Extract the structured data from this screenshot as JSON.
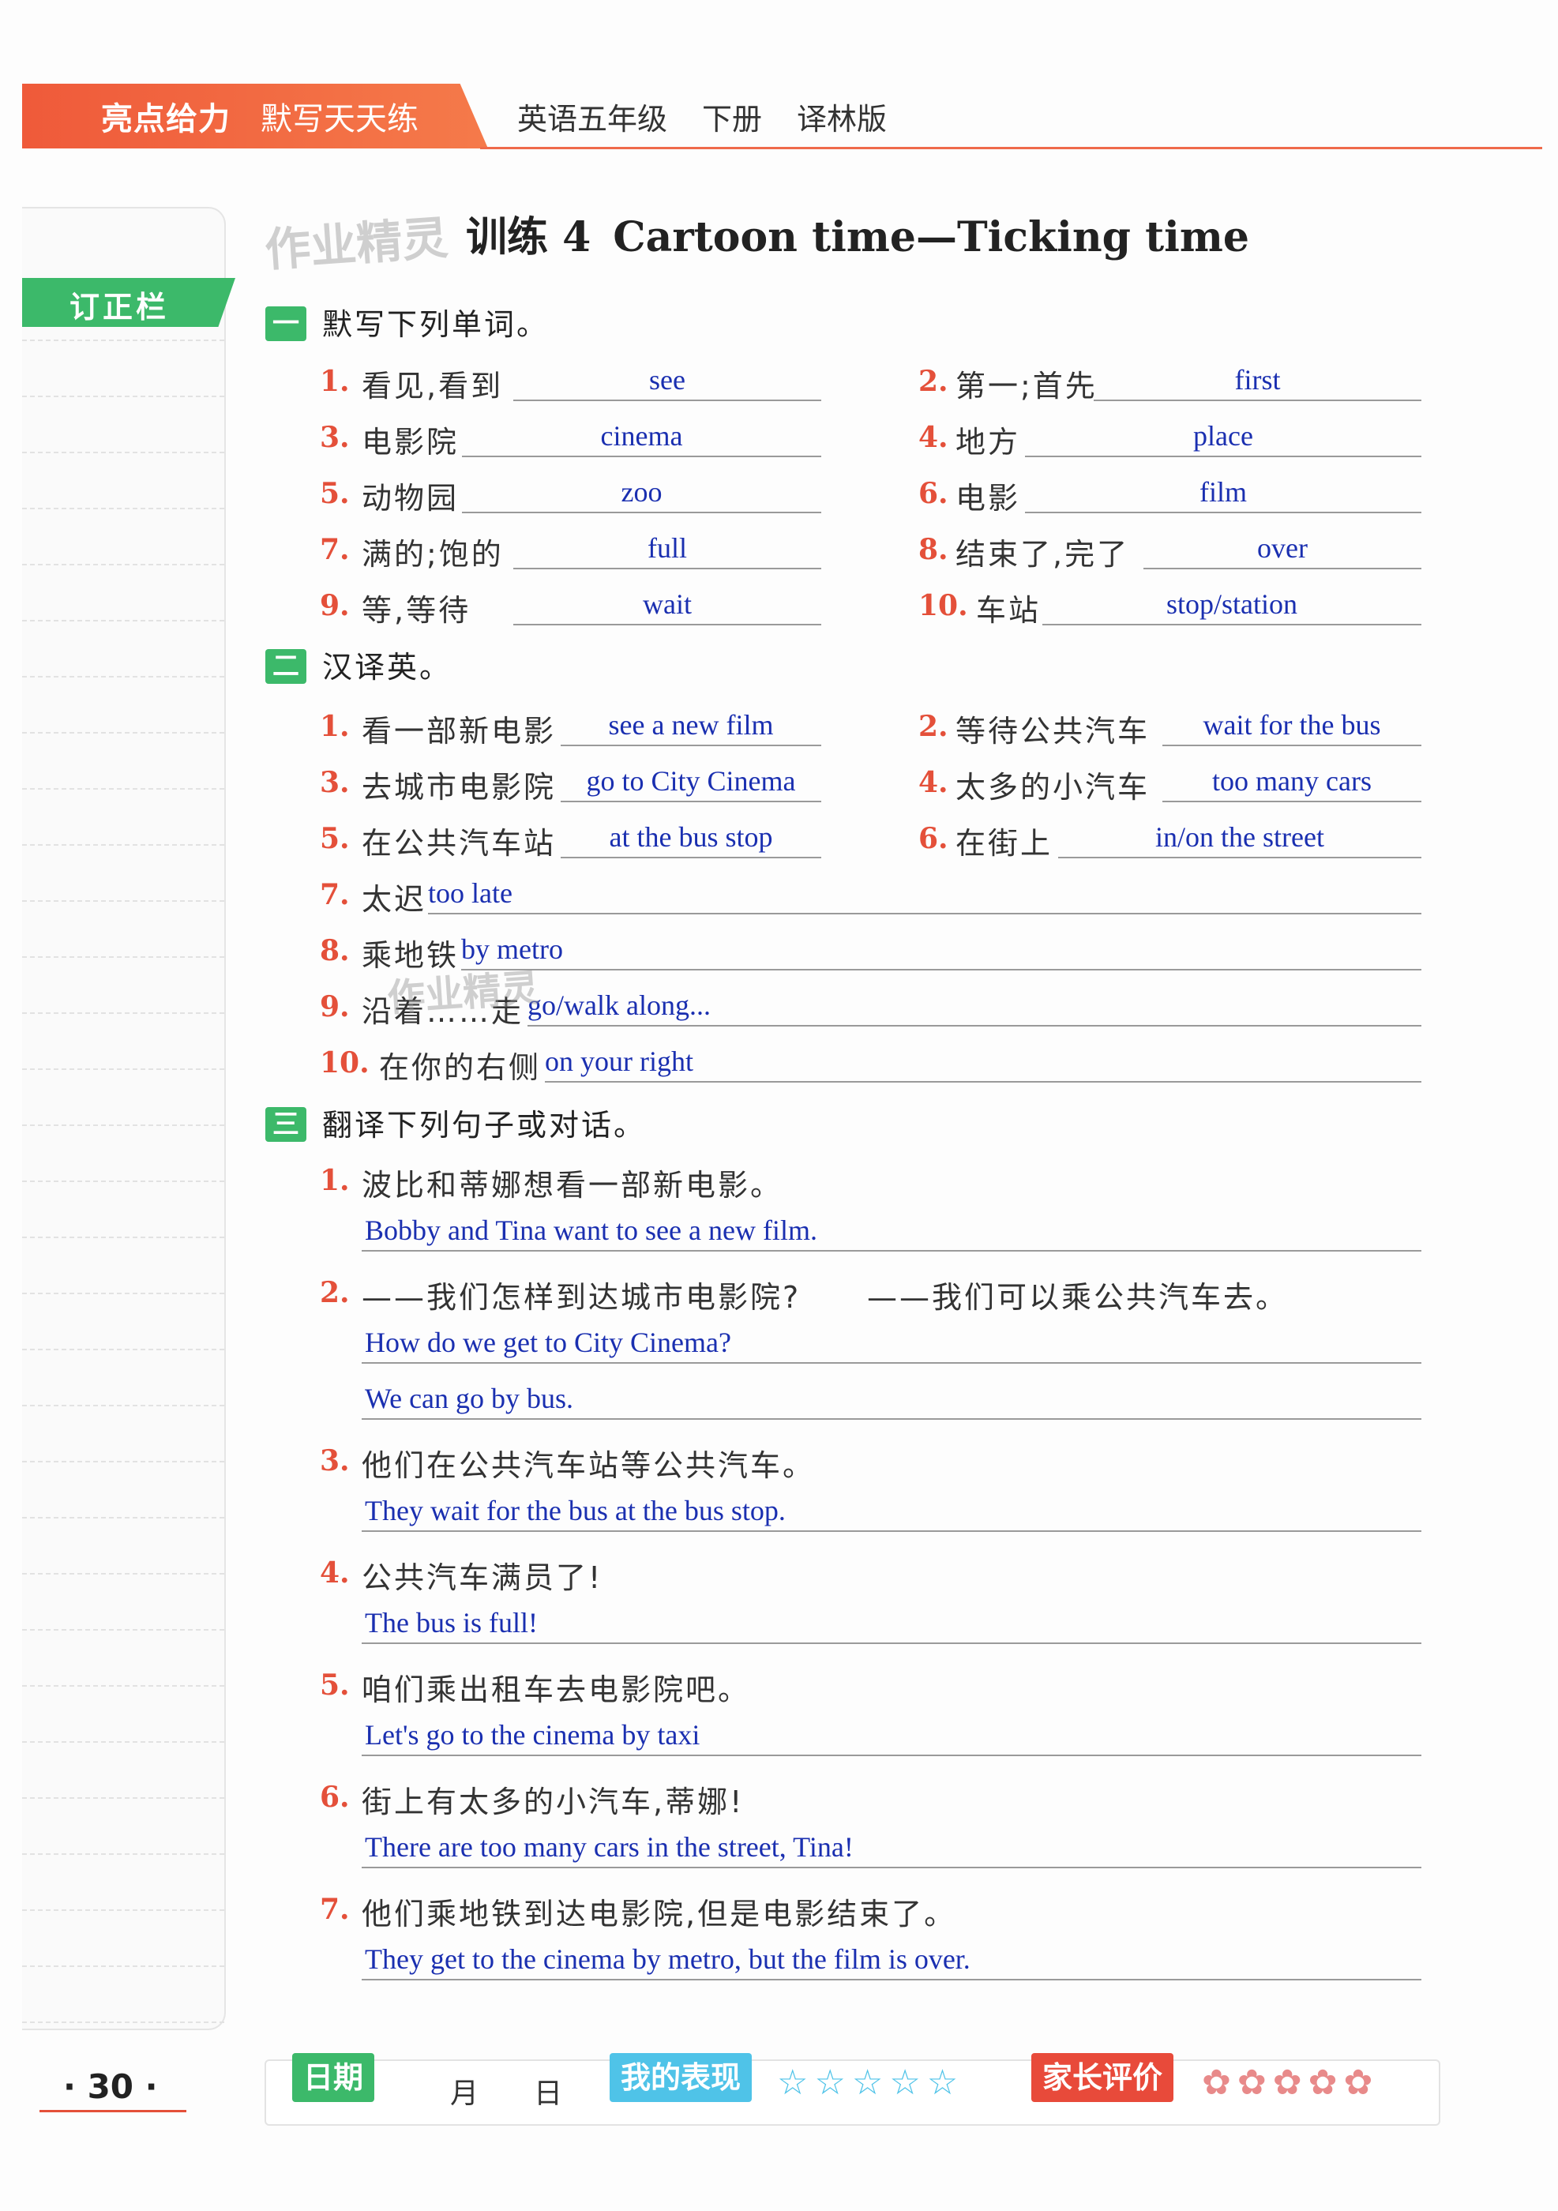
{
  "header": {
    "brand": "亮点给力",
    "series": "默写天天练",
    "subject": "英语五年级",
    "volume": "下册",
    "edition": "译林版"
  },
  "sidebar": {
    "tab_label": "订正栏"
  },
  "watermark": "作业精灵",
  "title": {
    "cn": "训练 4",
    "en": "Cartoon time—Ticking time"
  },
  "section1": {
    "badge": "一",
    "title": "默写下列单词。",
    "items": [
      {
        "num": "1.",
        "cn": "看见,看到",
        "answer": "see"
      },
      {
        "num": "2.",
        "cn": "第一;首先",
        "answer": "first"
      },
      {
        "num": "3.",
        "cn": "电影院",
        "answer": "cinema"
      },
      {
        "num": "4.",
        "cn": "地方",
        "answer": "place"
      },
      {
        "num": "5.",
        "cn": "动物园",
        "answer": "zoo"
      },
      {
        "num": "6.",
        "cn": "电影",
        "answer": "film"
      },
      {
        "num": "7.",
        "cn": "满的;饱的",
        "answer": "full"
      },
      {
        "num": "8.",
        "cn": "结束了,完了",
        "answer": "over"
      },
      {
        "num": "9.",
        "cn": "等,等待",
        "answer": "wait"
      },
      {
        "num": "10.",
        "cn": "车站",
        "answer": "stop/station"
      }
    ]
  },
  "section2": {
    "badge": "二",
    "title": "汉译英。",
    "items": [
      {
        "num": "1.",
        "cn": "看一部新电影",
        "answer": "see a new film"
      },
      {
        "num": "2.",
        "cn": "等待公共汽车",
        "answer": "wait for the bus"
      },
      {
        "num": "3.",
        "cn": "去城市电影院",
        "answer": "go to City Cinema"
      },
      {
        "num": "4.",
        "cn": "太多的小汽车",
        "answer": "too many cars"
      },
      {
        "num": "5.",
        "cn": "在公共汽车站",
        "answer": "at the bus stop"
      },
      {
        "num": "6.",
        "cn": "在街上",
        "answer": "in/on the street"
      },
      {
        "num": "7.",
        "cn": "太迟",
        "answer": "too late"
      },
      {
        "num": "8.",
        "cn": "乘地铁",
        "answer": "by metro"
      },
      {
        "num": "9.",
        "cn": "沿着……走",
        "answer": "go/walk along..."
      },
      {
        "num": "10.",
        "cn": "在你的右侧",
        "answer": "on your right"
      }
    ]
  },
  "section3": {
    "badge": "三",
    "title": "翻译下列句子或对话。",
    "items": [
      {
        "num": "1.",
        "cn": "波比和蒂娜想看一部新电影。",
        "answers": [
          "Bobby and Tina want to see a new film."
        ]
      },
      {
        "num": "2.",
        "cn": "——我们怎样到达城市电影院?",
        "cn2": "——我们可以乘公共汽车去。",
        "answers": [
          "How do we get to City Cinema?",
          "We can go by bus."
        ]
      },
      {
        "num": "3.",
        "cn": "他们在公共汽车站等公共汽车。",
        "answers": [
          "They wait for the bus at the bus stop."
        ]
      },
      {
        "num": "4.",
        "cn": "公共汽车满员了!",
        "answers": [
          "The bus is full!"
        ]
      },
      {
        "num": "5.",
        "cn": "咱们乘出租车去电影院吧。",
        "answers": [
          "Let's go to the cinema by taxi"
        ]
      },
      {
        "num": "6.",
        "cn": "街上有太多的小汽车,蒂娜!",
        "answers": [
          "There are too many cars in the street, Tina!"
        ]
      },
      {
        "num": "7.",
        "cn": "他们乘地铁到达电影院,但是电影结束了。",
        "answers": [
          "They get to the cinema by metro, but the film is over."
        ]
      }
    ]
  },
  "footer": {
    "page": "· 30 ·",
    "date_label": "日期",
    "month": "月",
    "day": "日",
    "performance_label": "我的表现",
    "performance_stars": "☆☆☆☆☆",
    "parent_label": "家长评价",
    "parent_flowers": "✿✿✿✿✿",
    "colors": {
      "accent": "#e4503a",
      "green": "#3cb96a",
      "answer": "#1a2fb0",
      "blue_badge": "#4fc3e8",
      "red_badge": "#e84a3a"
    }
  }
}
